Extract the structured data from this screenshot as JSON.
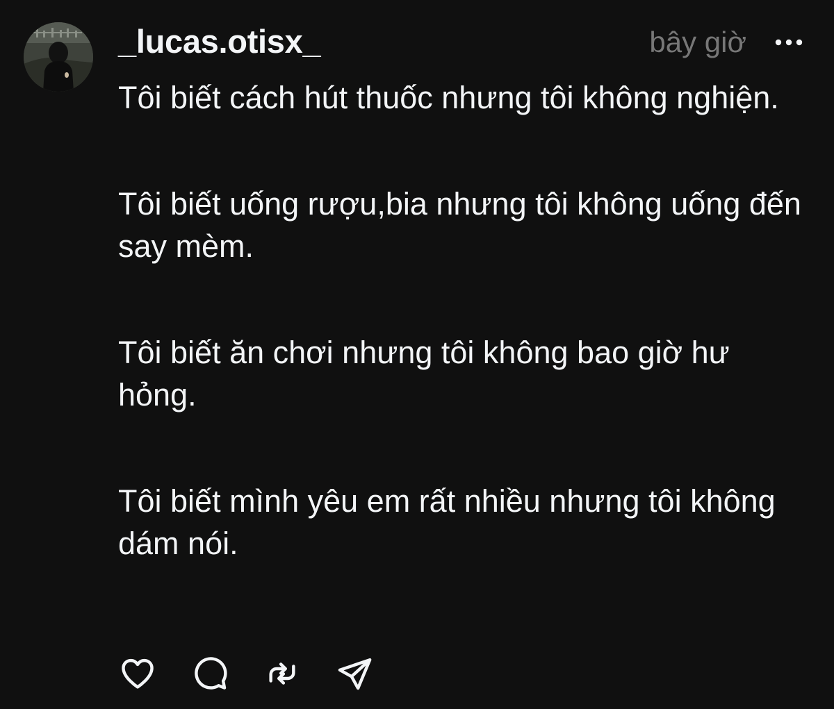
{
  "post": {
    "username": "_lucas.otisx_",
    "timestamp": "bây giờ",
    "paragraphs": [
      "Tôi biết cách hút thuốc nhưng tôi không nghiện.",
      "Tôi biết uống rượu,bia nhưng tôi không uống đến say mèm.",
      "Tôi biết ăn chơi nhưng tôi không bao giờ hư hỏng.",
      "Tôi biết mình yêu em rất nhiều nhưng tôi không dám nói."
    ]
  },
  "icons": {
    "more": "more-horizontal-icon",
    "like": "heart-icon",
    "reply": "comment-icon",
    "repost": "repost-icon",
    "share": "send-icon"
  },
  "colors": {
    "background": "#101010",
    "text": "#f3f5f7",
    "muted": "#777777"
  }
}
